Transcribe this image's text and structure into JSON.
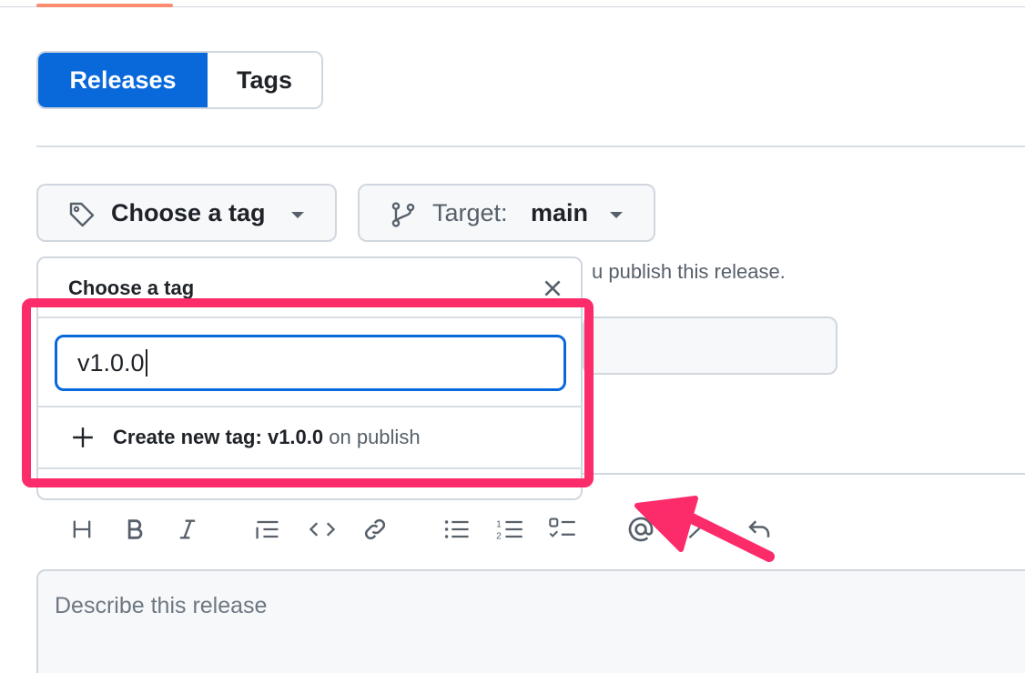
{
  "tabs": {
    "releases_label": "Releases",
    "tags_label": "Tags"
  },
  "controls": {
    "choose_tag_label": "Choose a tag",
    "target_prefix": "Target:",
    "target_value": "main"
  },
  "helper_text": "u publish this release.",
  "tag_dropdown": {
    "title": "Choose a tag",
    "input_value": "v1.0.0",
    "create_prefix": "Create new tag:",
    "create_tag": "v1.0.0",
    "create_suffix": "on publish"
  },
  "editor": {
    "placeholder": "Describe this release",
    "toolbar_icons": [
      "heading-icon",
      "bold-icon",
      "italic-icon",
      "quote-icon",
      "code-icon",
      "link-icon",
      "unordered-list-icon",
      "ordered-list-icon",
      "task-list-icon",
      "mention-icon",
      "cross-reference-icon",
      "reply-icon"
    ]
  },
  "colors": {
    "accent": "#0969da",
    "highlight": "#fc2b6a"
  }
}
